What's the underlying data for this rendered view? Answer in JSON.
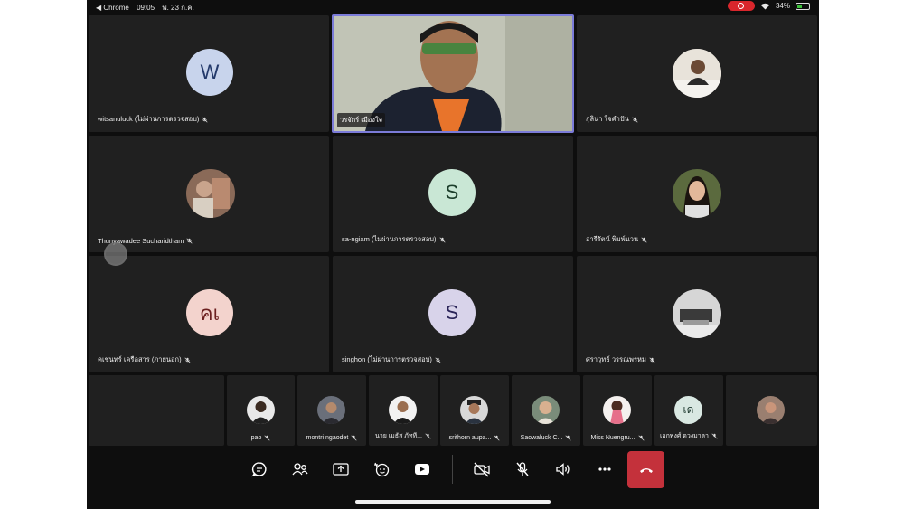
{
  "status_bar": {
    "app": "◀ Chrome",
    "time": "09:05",
    "date": "พ. 23 ก.ค.",
    "battery": "34%"
  },
  "participants_large": [
    {
      "name": "witsanuluck (ไม่ผ่านการตรวจสอบ)",
      "initial": "W",
      "avatar_bg": "#c8d4ec",
      "avatar_fg": "#243a6b",
      "type": "initial"
    },
    {
      "name": "วรจักร์ เมืองใจ",
      "type": "video"
    },
    {
      "name": "กุลินา ใจคำปัน",
      "type": "photo"
    },
    {
      "name": "Thunyawadee Sucharidtham",
      "type": "photo"
    },
    {
      "name": "sa-ngiam (ไม่ผ่านการตรวจสอบ)",
      "initial": "S",
      "avatar_bg": "#c9e7d5",
      "avatar_fg": "#1c3e2b",
      "type": "initial"
    },
    {
      "name": "อารีรัตน์ พิมพ์นวน",
      "type": "photo"
    },
    {
      "name": "คเชนทร์ เครือสาร (ภายนอก)",
      "initial": "คเ",
      "avatar_bg": "#f3d3cd",
      "avatar_fg": "#6b1f1f",
      "type": "initial"
    },
    {
      "name": "singhon (ไม่ผ่านการตรวจสอบ)",
      "initial": "S",
      "avatar_bg": "#d8d3ea",
      "avatar_fg": "#2a2458",
      "type": "initial"
    },
    {
      "name": "ศราวุทธ์ วรรณพรหม",
      "type": "photo"
    }
  ],
  "participants_small": [
    {
      "name": "pao",
      "type": "photo"
    },
    {
      "name": "montri ngaodet",
      "type": "photo"
    },
    {
      "name": "นาย เมธัส ภัทที...",
      "type": "photo"
    },
    {
      "name": "srithorn aupa...",
      "type": "photo"
    },
    {
      "name": "Saowaluck C...",
      "type": "photo"
    },
    {
      "name": "Miss Nuengru...",
      "type": "photo"
    },
    {
      "name": "เอกพงศ์ ดวงมาลา",
      "initial": "เด",
      "avatar_bg": "#d9e8e2",
      "avatar_fg": "#1f3a30",
      "type": "initial"
    },
    {
      "name": "",
      "type": "photo"
    }
  ],
  "toolbar": {
    "items": [
      "chat-icon",
      "people-icon",
      "share-screen-icon",
      "reactions-icon",
      "video-icon",
      "camera-off-icon",
      "mic-off-icon",
      "speaker-icon",
      "more-icon",
      "end-call-icon"
    ]
  },
  "colors": {
    "active_speaker_border": "#7b7bd8",
    "end_call": "#c4313b",
    "tile_bg": "#202020",
    "recording": "#d9262c"
  }
}
